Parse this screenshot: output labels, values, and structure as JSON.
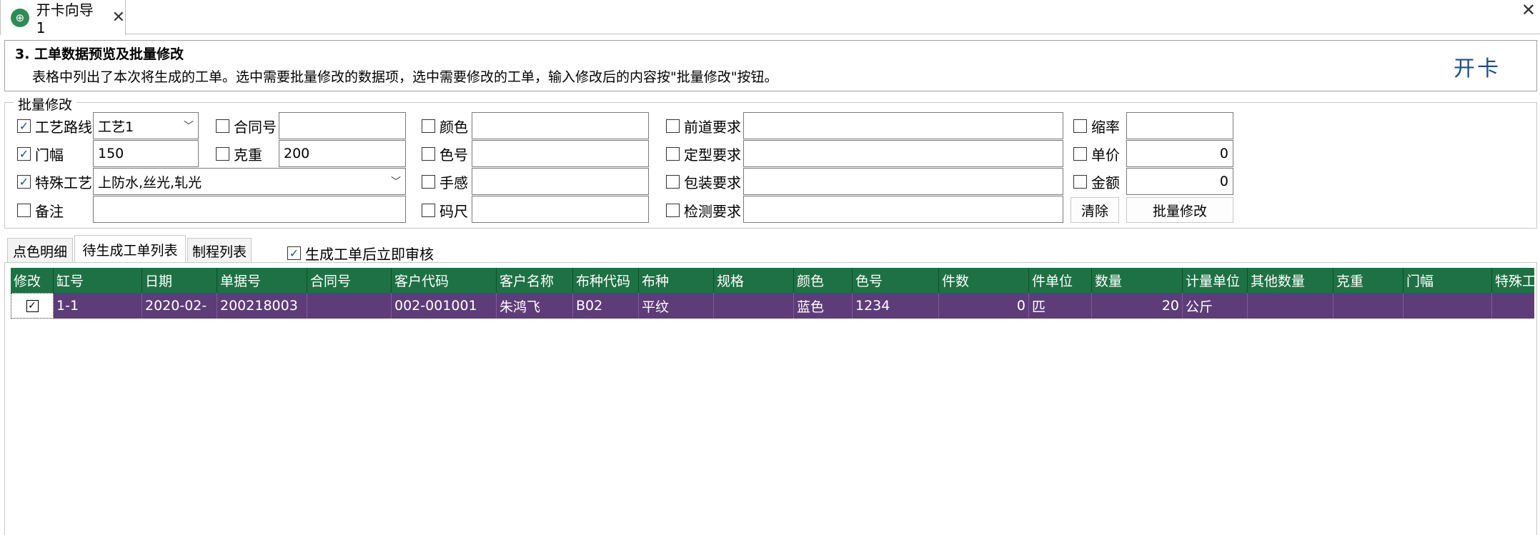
{
  "tab": {
    "title": "开卡向导1",
    "close": "✕"
  },
  "window": {
    "close": "✕"
  },
  "header": {
    "step_title": "3.  工单数据预览及批量修改",
    "description": "表格中列出了本次将生成的工单。选中需要批量修改的数据项，选中需要修改的工单，输入修改后的内容按\"批量修改\"按钮。",
    "brand": "开卡"
  },
  "batch": {
    "title": "批量修改",
    "fields": {
      "route": {
        "label": "工艺路线",
        "checked": true,
        "value": "工艺1"
      },
      "contract": {
        "label": "合同号",
        "checked": false,
        "value": ""
      },
      "color": {
        "label": "颜色",
        "checked": false,
        "value": ""
      },
      "pre_req": {
        "label": "前道要求",
        "checked": false,
        "value": ""
      },
      "shrink": {
        "label": "缩率",
        "checked": false,
        "value": ""
      },
      "width": {
        "label": "门幅",
        "checked": true,
        "value": "150"
      },
      "weight": {
        "label": "克重",
        "checked": false,
        "value": "200"
      },
      "color_no": {
        "label": "色号",
        "checked": false,
        "value": ""
      },
      "setting_req": {
        "label": "定型要求",
        "checked": false,
        "value": ""
      },
      "unit_price": {
        "label": "单价",
        "checked": false,
        "value": "0"
      },
      "special": {
        "label": "特殊工艺",
        "checked": true,
        "value": "上防水,丝光,轧光"
      },
      "hand_feel": {
        "label": "手感",
        "checked": false,
        "value": ""
      },
      "pack_req": {
        "label": "包装要求",
        "checked": false,
        "value": ""
      },
      "amount": {
        "label": "金额",
        "checked": false,
        "value": "0"
      },
      "remark": {
        "label": "备注",
        "checked": false,
        "value": ""
      },
      "yard": {
        "label": "码尺",
        "checked": false,
        "value": ""
      },
      "test_req": {
        "label": "检测要求",
        "checked": false,
        "value": ""
      }
    },
    "clear_label": "清除",
    "apply_label": "批量修改"
  },
  "subtabs": [
    "点色明细",
    "待生成工单列表",
    "制程列表"
  ],
  "audit": {
    "label": "生成工单后立即审核",
    "checked": true
  },
  "grid": {
    "columns": [
      "修改",
      "缸号",
      "日期",
      "单据号",
      "合同号",
      "客户代码",
      "客户名称",
      "布种代码",
      "布种",
      "规格",
      "颜色",
      "色号",
      "件数",
      "件单位",
      "数量",
      "计量单位",
      "其他数量",
      "克重",
      "门幅",
      "特殊工"
    ],
    "rows": [
      {
        "checked": true,
        "cells": [
          "1-1",
          "2020-02-",
          "200218003",
          "",
          "002-001001",
          "朱鸿飞",
          "B02",
          "平纹",
          "",
          "蓝色",
          "1234",
          "0",
          "匹",
          "20",
          "公斤",
          "",
          "",
          "",
          ""
        ]
      }
    ]
  }
}
